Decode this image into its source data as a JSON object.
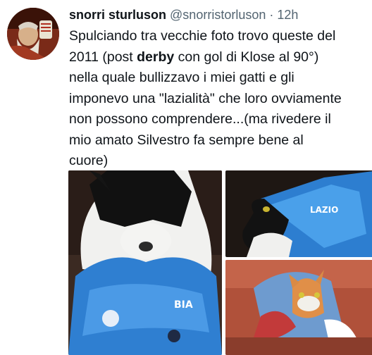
{
  "author": {
    "display_name": "snorri sturluson",
    "handle": "@snorristorluson",
    "separator": "·",
    "timestamp": "12h"
  },
  "tweet": {
    "line1": "Spulciando tra vecchie foto trovo queste del",
    "line2_before": "2011 (post ",
    "line2_bold": "derby",
    "line2_after": " con gol di Klose al 90°)",
    "line3": "nella quale bullizzavo i miei gatti e gli",
    "line4": "imponevo una \"lazialità\" che loro ovviamente",
    "line5": "non possono comprendere...(ma rivedere il",
    "line6": "mio amato Silvestro fa sempre bene al",
    "line7": "cuore)"
  },
  "media": {
    "photos": [
      {
        "subject": "black-and-white cat wearing blue Lazio scarf"
      },
      {
        "subject": "black-and-white cat with blue scarf on head"
      },
      {
        "subject": "orange cat wrapped in blue Lazio scarf"
      }
    ]
  }
}
